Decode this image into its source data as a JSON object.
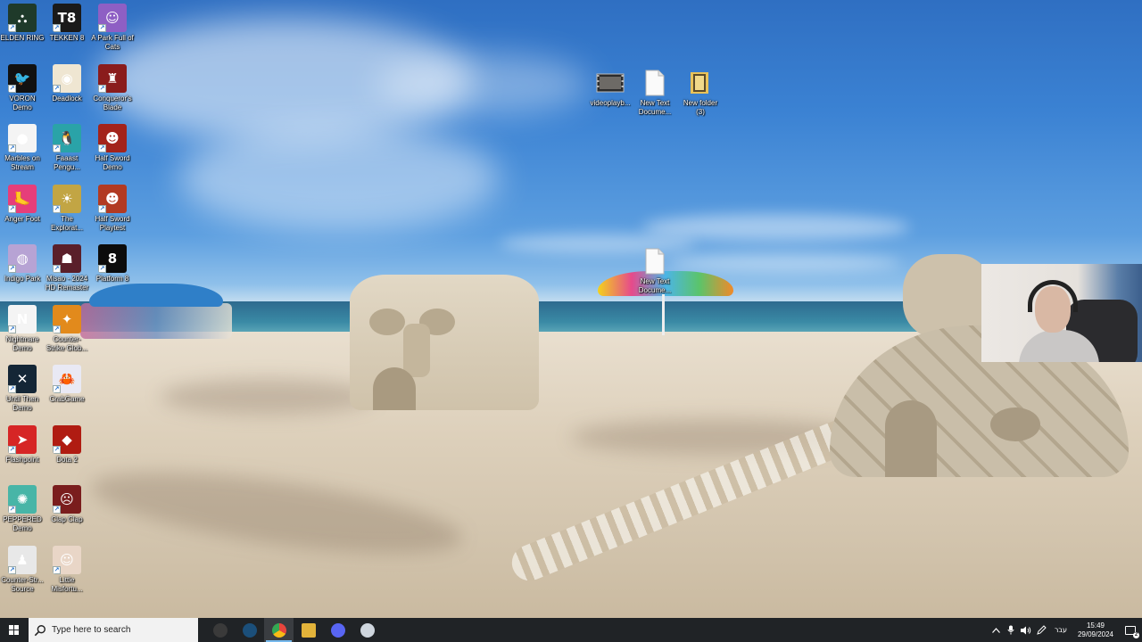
{
  "desktop": {
    "icons": [
      {
        "label": "ELDEN RING",
        "icon": "elden-ring-icon",
        "bg": "#1f3a2a",
        "glyph": "⛬"
      },
      {
        "label": "TEKKEN 8",
        "icon": "tekken-icon",
        "bg": "#1a1a1a",
        "glyph": "T8"
      },
      {
        "label": "A Park Full of Cats",
        "icon": "cat-park-icon",
        "bg": "#8e5fc4",
        "glyph": "☺"
      },
      {
        "label": "VORON Demo",
        "icon": "voron-icon",
        "bg": "#111111",
        "glyph": "🐦"
      },
      {
        "label": "Deadlock",
        "icon": "deadlock-icon",
        "bg": "#efe6d2",
        "glyph": "◉"
      },
      {
        "label": "Conqueror's Blade",
        "icon": "conquerors-blade-icon",
        "bg": "#8a1c1c",
        "glyph": "♜"
      },
      {
        "label": "Marbles on Stream",
        "icon": "marbles-icon",
        "bg": "#f4f4f4",
        "glyph": "●"
      },
      {
        "label": "Faaast Pengu...",
        "icon": "penguin-icon",
        "bg": "#2aa3a8",
        "glyph": "🐧"
      },
      {
        "label": "Half Sword Demo",
        "icon": "half-sword-demo-icon",
        "bg": "#a3231b",
        "glyph": "☻"
      },
      {
        "label": "Anger Foot",
        "icon": "anger-foot-icon",
        "bg": "#e63e7a",
        "glyph": "🦶"
      },
      {
        "label": "The Explorat...",
        "icon": "exploration-icon",
        "bg": "#c2a544",
        "glyph": "☀"
      },
      {
        "label": "Half Sword Playtest",
        "icon": "half-sword-playtest-icon",
        "bg": "#b23a22",
        "glyph": "☻"
      },
      {
        "label": "Indigo Park",
        "icon": "indigo-park-icon",
        "bg": "#b7a3d4",
        "glyph": "◍"
      },
      {
        "label": "Misao - 2024 HD Remaster",
        "icon": "misao-icon",
        "bg": "#5a1f2a",
        "glyph": "☗"
      },
      {
        "label": "Platform 8",
        "icon": "platform-8-icon",
        "bg": "#0c0c0c",
        "glyph": "8"
      },
      {
        "label": "Nightmare Demo",
        "icon": "nightmare-demo-icon",
        "bg": "#f4f4f4",
        "glyph": "N"
      },
      {
        "label": "Counter-Strike Glob...",
        "icon": "csgo-icon",
        "bg": "#e28a1c",
        "glyph": "✦"
      },
      {
        "label": "",
        "icon": "blank-slot",
        "bg": "transparent",
        "glyph": ""
      },
      {
        "label": "Until Then Demo",
        "icon": "until-then-icon",
        "bg": "#142636",
        "glyph": "✕"
      },
      {
        "label": "CrabGame",
        "icon": "crab-game-icon",
        "bg": "#e9e9f4",
        "glyph": "🦀"
      },
      {
        "label": "",
        "icon": "blank-slot",
        "bg": "transparent",
        "glyph": ""
      },
      {
        "label": "Flashpoint",
        "icon": "flashpoint-icon",
        "bg": "#d62525",
        "glyph": "➤"
      },
      {
        "label": "Dota 2",
        "icon": "dota-2-icon",
        "bg": "#b01c12",
        "glyph": "◆"
      },
      {
        "label": "",
        "icon": "blank-slot",
        "bg": "transparent",
        "glyph": ""
      },
      {
        "label": "PEPPERED Demo",
        "icon": "peppered-icon",
        "bg": "#48b5a7",
        "glyph": "✺"
      },
      {
        "label": "Clap Clap",
        "icon": "clap-clap-icon",
        "bg": "#7a1d1d",
        "glyph": "☹"
      },
      {
        "label": "",
        "icon": "blank-slot",
        "bg": "transparent",
        "glyph": ""
      },
      {
        "label": "Counter-Str... Source",
        "icon": "css-icon",
        "bg": "#e8e8e8",
        "glyph": "♟"
      },
      {
        "label": "Little Misfortu...",
        "icon": "little-misfortune-icon",
        "bg": "#e9d6c7",
        "glyph": "☺"
      }
    ],
    "files": [
      {
        "label": "videoplayb...",
        "icon": "video-file-icon",
        "type": "video"
      },
      {
        "label": "New Text Docume...",
        "icon": "text-file-icon",
        "type": "text"
      },
      {
        "label": "New folder (3)",
        "icon": "folder-icon",
        "type": "folder"
      },
      {
        "label": "New Text Docume...",
        "icon": "text-file-icon",
        "type": "text"
      }
    ]
  },
  "taskbar": {
    "search_placeholder": "Type here to search",
    "apps": [
      {
        "name": "obs-app",
        "icon": "obs-icon",
        "color": "#3a3a3a",
        "active": false
      },
      {
        "name": "steam-app",
        "icon": "steam-icon",
        "color": "#1b4f7a",
        "active": false
      },
      {
        "name": "chrome-app",
        "icon": "chrome-icon",
        "color": "#e8453c",
        "active": true
      },
      {
        "name": "files-app",
        "icon": "file-explorer-icon",
        "color": "#e2b33a",
        "active": false
      },
      {
        "name": "discord-app",
        "icon": "discord-icon",
        "color": "#5865f2",
        "active": false
      },
      {
        "name": "game-app",
        "icon": "game-icon",
        "color": "#cfd6de",
        "active": false
      }
    ],
    "tray": {
      "language": "עבר",
      "time": "15:49",
      "date": "29/09/2024",
      "notification_count": "2"
    }
  },
  "colors": {
    "taskbar_bg": "#202326",
    "accent": "#76b9ed",
    "label_text": "#ffffff"
  }
}
